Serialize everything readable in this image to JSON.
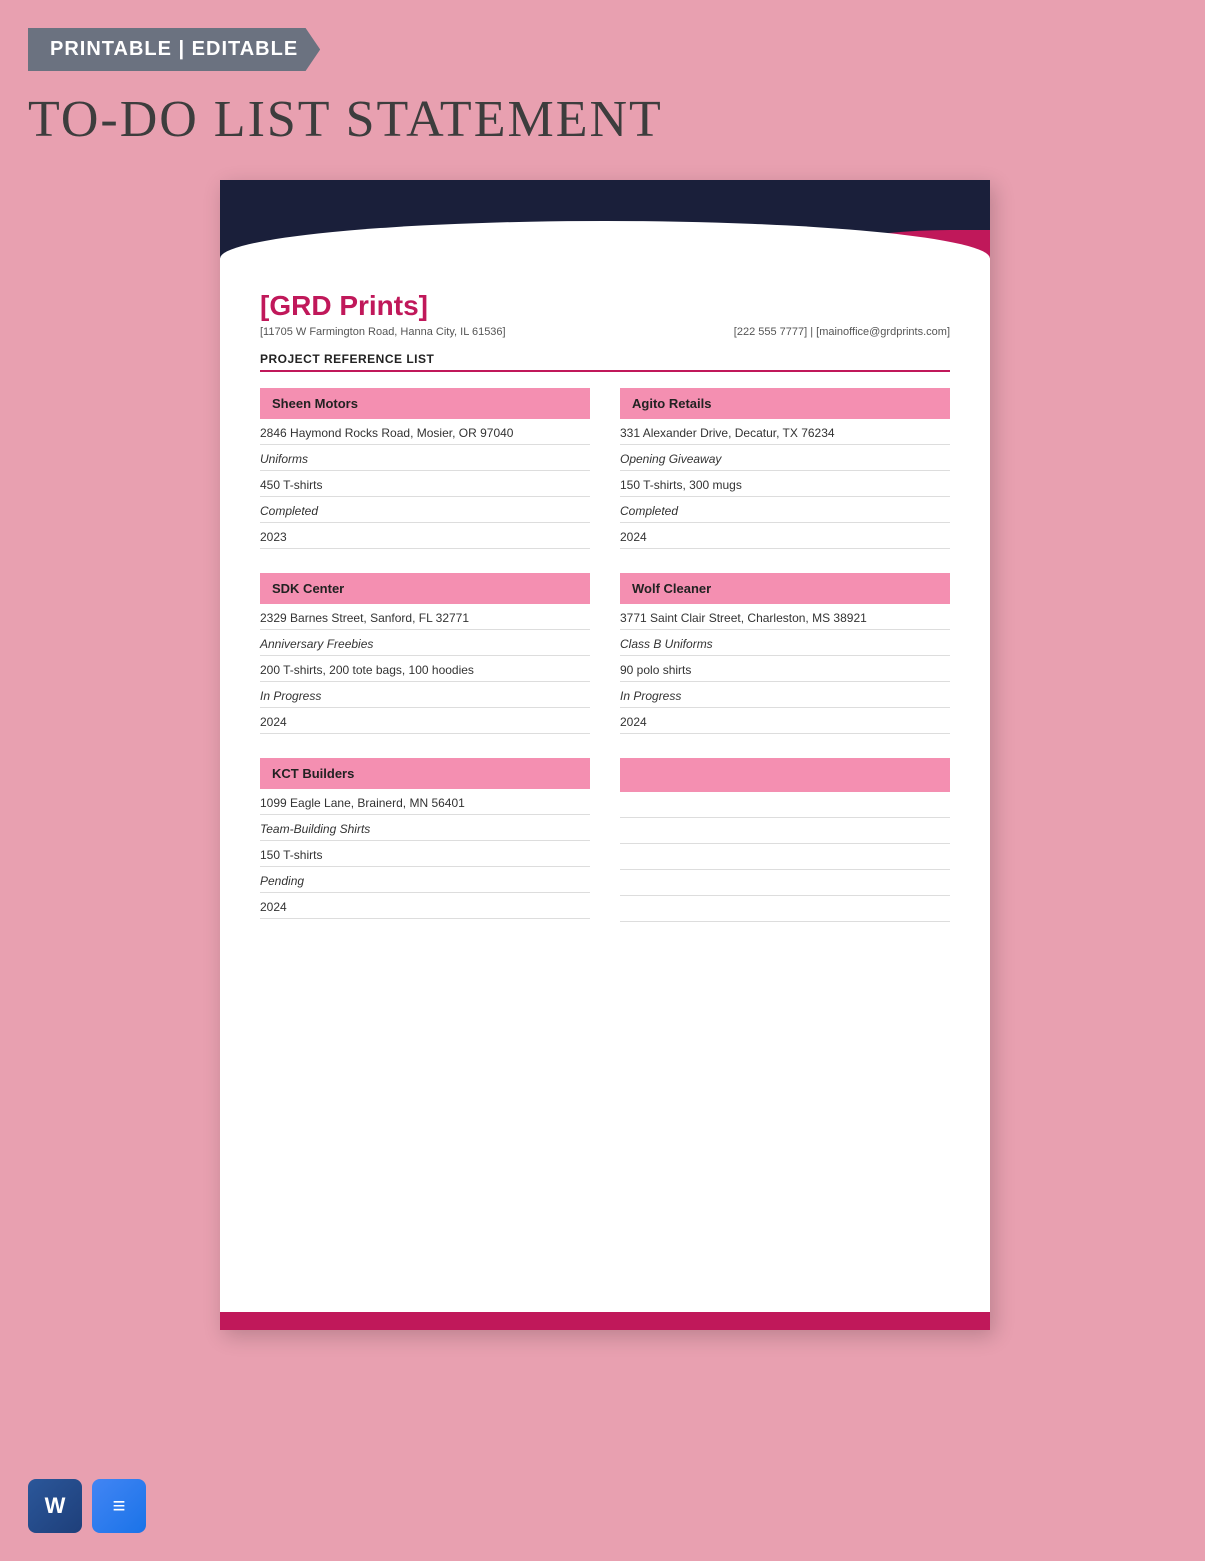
{
  "banner": {
    "text": "PRINTABLE | EDITABLE"
  },
  "page_title": "TO-DO LIST STATEMENT",
  "company": {
    "name": "[GRD Prints]",
    "address": "[11705 W Farmington Road, Hanna City, IL 61536]",
    "contact": "[222 555 7777] | [mainoffice@grdprints.com]",
    "section_title": "PROJECT REFERENCE LIST"
  },
  "projects": [
    {
      "name": "Sheen Motors",
      "address": "2846 Haymond Rocks Road, Mosier, OR 97040",
      "project_type": "Uniforms",
      "items": "450 T-shirts",
      "status": "Completed",
      "year": "2023"
    },
    {
      "name": "Agito Retails",
      "address": "331 Alexander Drive, Decatur, TX 76234",
      "project_type": "Opening Giveaway",
      "items": "150 T-shirts, 300 mugs",
      "status": "Completed",
      "year": "2024"
    },
    {
      "name": "SDK Center",
      "address": "2329 Barnes Street, Sanford, FL 32771",
      "project_type": "Anniversary Freebies",
      "items": "200 T-shirts, 200 tote bags, 100 hoodies",
      "status": "In Progress",
      "year": "2024"
    },
    {
      "name": "Wolf Cleaner",
      "address": "3771 Saint Clair Street, Charleston, MS 38921",
      "project_type": "Class B Uniforms",
      "items": "90 polo shirts",
      "status": "In Progress",
      "year": "2024"
    },
    {
      "name": "KCT Builders",
      "address": "1099 Eagle Lane, Brainerd, MN 56401",
      "project_type": "Team-Building Shirts",
      "items": "150 T-shirts",
      "status": "Pending",
      "year": "2024"
    },
    {
      "name": "",
      "address": "",
      "project_type": "",
      "items": "",
      "status": "",
      "year": ""
    }
  ],
  "icons": {
    "word_label": "W",
    "docs_label": "≡"
  }
}
